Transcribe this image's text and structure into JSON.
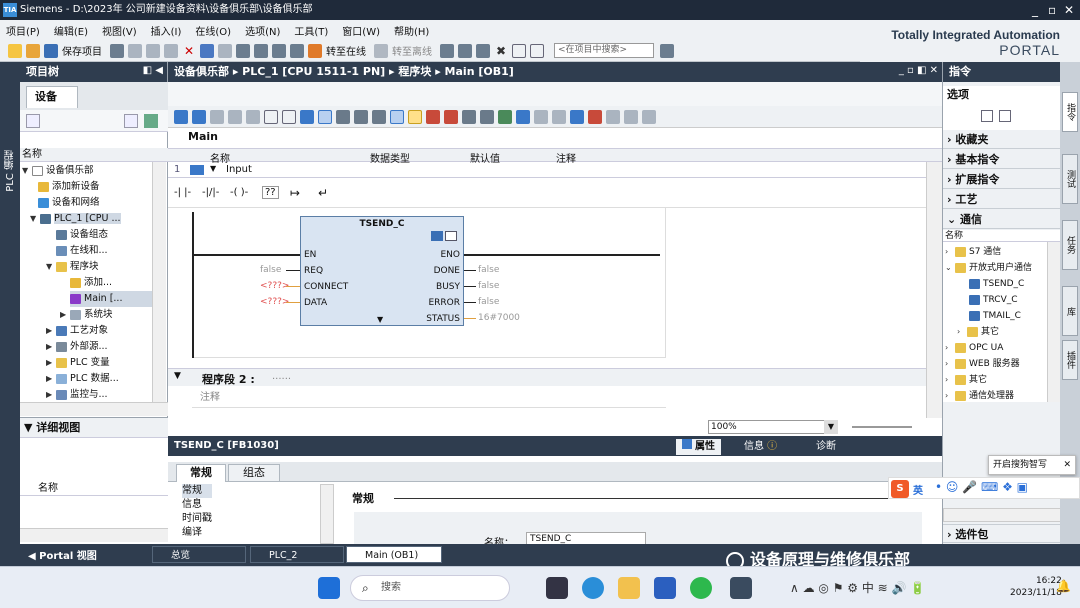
{
  "titlebar": {
    "app": "Siemens",
    "path": "D:\\2023年 公司新建设备资料\\设备俱乐部\\设备俱乐部"
  },
  "menu": [
    "项目(P)",
    "编辑(E)",
    "视图(V)",
    "插入(I)",
    "在线(O)",
    "选项(N)",
    "工具(T)",
    "窗口(W)",
    "帮助(H)"
  ],
  "brand": {
    "line1": "Totally Integrated Automation",
    "line2": "PORTAL"
  },
  "toolbar": {
    "save": "保存项目",
    "go_online": "转至在线",
    "go_offline": "转至离线",
    "search_placeholder": "<在项目中搜索>"
  },
  "sidetab": "PLC 编程",
  "project": {
    "title": "项目树",
    "tab": "设备",
    "col_name": "名称",
    "items": [
      {
        "label": "设备俱乐部",
        "arrow": "▼"
      },
      {
        "label": "添加新设备",
        "arrow": ""
      },
      {
        "label": "设备和网络",
        "arrow": ""
      },
      {
        "label": "PLC_1 [CPU ...",
        "arrow": "▼"
      },
      {
        "label": "设备组态",
        "arrow": ""
      },
      {
        "label": "在线和...",
        "arrow": ""
      },
      {
        "label": "程序块",
        "arrow": "▼"
      },
      {
        "label": "添加...",
        "arrow": ""
      },
      {
        "label": "Main [...",
        "arrow": ""
      },
      {
        "label": "系统块",
        "arrow": "▶"
      },
      {
        "label": "工艺对象",
        "arrow": "▶"
      },
      {
        "label": "外部源...",
        "arrow": "▶"
      },
      {
        "label": "PLC 变量",
        "arrow": "▶"
      },
      {
        "label": "PLC 数据...",
        "arrow": "▶"
      },
      {
        "label": "监控与...",
        "arrow": "▶"
      }
    ]
  },
  "detail": {
    "title": "详细视图",
    "col_name": "名称"
  },
  "editor": {
    "breadcrumb": "设备俱乐部 ▸ PLC_1 [CPU 1511-1 PN] ▸ 程序块 ▸ Main [OB1]",
    "block_name": "Main",
    "iface_cols": [
      "名称",
      "数据类型",
      "默认值",
      "注释"
    ],
    "iface_row_num": "1",
    "iface_row": "Input",
    "ladder_btns": [
      "-| |-",
      "-|/|-",
      "-( )-",
      "??",
      "↦",
      "↵"
    ],
    "fb": {
      "name": "TSEND_C",
      "left_pins": [
        "EN",
        "REQ",
        "CONNECT",
        "DATA"
      ],
      "left_vals": [
        "",
        "false",
        "<???>",
        "<???>"
      ],
      "right_pins": [
        "ENO",
        "DONE",
        "BUSY",
        "ERROR",
        "STATUS"
      ],
      "right_vals": [
        "",
        "false",
        "false",
        "false",
        "16#7000"
      ]
    },
    "network2": "程序段 2 :",
    "network2_dots": "......",
    "comment": "注释",
    "zoom": "100%"
  },
  "props": {
    "title": "TSEND_C [FB1030]",
    "tabs": [
      "属性",
      "信息",
      "诊断"
    ],
    "subtabs": [
      "常规",
      "组态"
    ],
    "nav": [
      "常规",
      "信息",
      "时间戳",
      "编译"
    ],
    "section": "常规",
    "field_label": "名称：",
    "field_value": "TSEND_C"
  },
  "instr": {
    "title": "指令",
    "options": "选项",
    "groups": [
      "收藏夹",
      "基本指令",
      "扩展指令",
      "工艺",
      "通信"
    ],
    "col_name": "名称",
    "comm_tree": [
      "S7 通信",
      "开放式用户通信",
      "TSEND_C",
      "TRCV_C",
      "TMAIL_C",
      "其它",
      "OPC UA",
      "WEB 服务器",
      "其它",
      "通信处理器"
    ],
    "options_pkg": "选件包"
  },
  "rtabs": [
    "指令",
    "测试",
    "任务",
    "库",
    "插件"
  ],
  "status": {
    "portal": "Portal 视图",
    "tabs": [
      "总览",
      "PLC_2",
      "Main (OB1)"
    ]
  },
  "popup": "开启搜狗智写",
  "ime": {
    "lang": "英"
  },
  "watermark": "设备原理与维修俱乐部",
  "taskbar": {
    "search": "搜索",
    "time": "16:22",
    "date": "2023/11/18"
  }
}
